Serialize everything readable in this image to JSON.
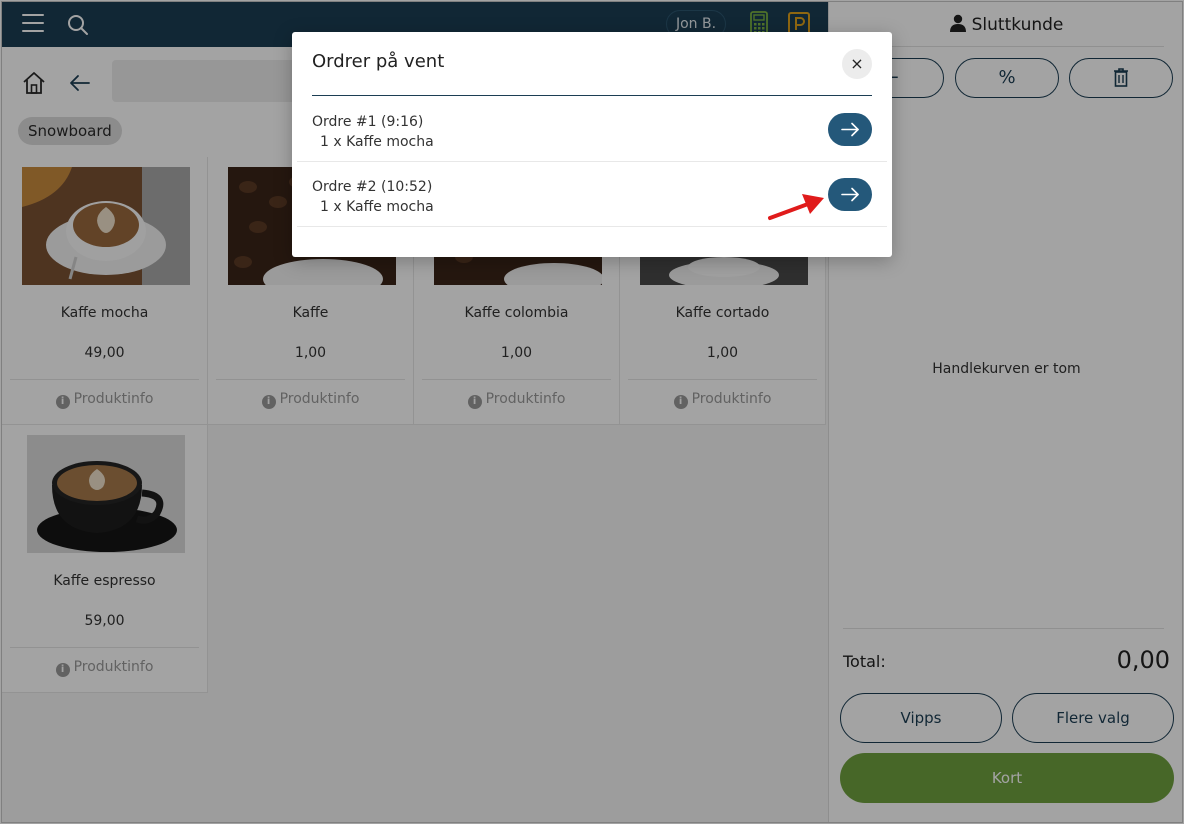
{
  "header": {
    "user_name": "Jon B."
  },
  "category": {
    "chip": "Snowboard"
  },
  "products": [
    {
      "name": "Kaffe mocha",
      "price": "49,00",
      "info": "Produktinfo"
    },
    {
      "name": "Kaffe",
      "price": "1,00",
      "info": "Produktinfo"
    },
    {
      "name": "Kaffe colombia",
      "price": "1,00",
      "info": "Produktinfo"
    },
    {
      "name": "Kaffe cortado",
      "price": "1,00",
      "info": "Produktinfo"
    },
    {
      "name": "Kaffe espresso",
      "price": "59,00",
      "info": "Produktinfo"
    }
  ],
  "cart": {
    "customer": "Sluttkunde",
    "empty_text": "Handlekurven er tom",
    "total_label": "Total:",
    "total_value": "0,00",
    "discount_symbol": "%",
    "buttons": {
      "vipps": "Vipps",
      "more": "Flere valg",
      "card": "Kort"
    }
  },
  "modal": {
    "title": "Ordrer på vent",
    "close": "×",
    "orders": [
      {
        "title": "Ordre #1 (9:16)",
        "item": "1 x Kaffe mocha"
      },
      {
        "title": "Ordre #2 (10:52)",
        "item": "1 x Kaffe mocha"
      }
    ]
  },
  "colors": {
    "primary": "#1c3e54",
    "accent_button": "#24587a",
    "pay_green": "#6fa13f",
    "calculator_icon": "#7cb342",
    "parking_icon": "#e0a11b",
    "pointer_arrow": "#e01b1b"
  },
  "icons": [
    "menu-icon",
    "search-icon",
    "calculator-icon",
    "parking-icon",
    "home-icon",
    "back-arrow-icon",
    "person-icon",
    "minus-icon",
    "percent-icon",
    "trash-icon",
    "close-icon",
    "arrow-right-icon",
    "info-icon"
  ]
}
